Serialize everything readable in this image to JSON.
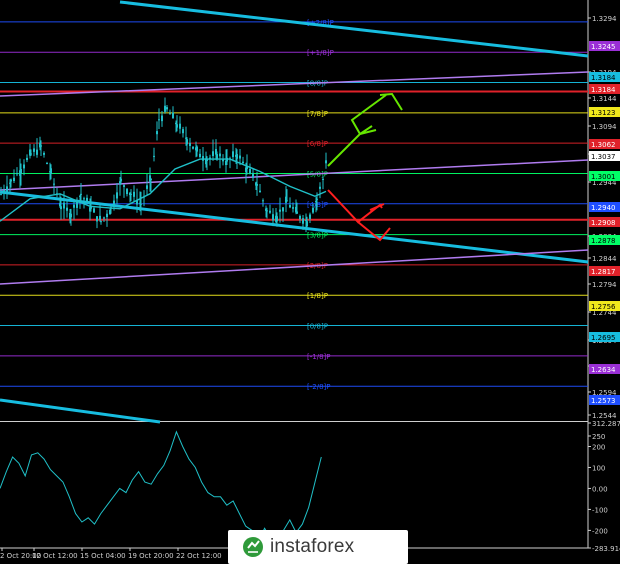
{
  "chart_data": {
    "type": "candlestick-with-oscillator",
    "price_axis_ticks": [
      "1.3294",
      "1.3194",
      "1.3144",
      "1.3094",
      "1.3037",
      "1.2944",
      "1.2894",
      "1.2844",
      "1.2794",
      "1.2744",
      "1.2694",
      "1.2644",
      "1.2594",
      "1.2544"
    ],
    "price_tags": [
      {
        "value": "1.3245",
        "color": "#9a2fd6"
      },
      {
        "value": "1.3184",
        "color": "#17bde0"
      },
      {
        "value": "1.3184",
        "color": "#e0222a"
      },
      {
        "value": "1.3123",
        "color": "#f0e81c"
      },
      {
        "value": "1.3062",
        "color": "#e0222a"
      },
      {
        "value": "1.3037",
        "color": "#ffffff"
      },
      {
        "value": "1.3001",
        "color": "#00ff66"
      },
      {
        "value": "1.2940",
        "color": "#1f4fff"
      },
      {
        "value": "1.2908",
        "color": "#e0222a"
      },
      {
        "value": "1.2878",
        "color": "#00ff66"
      },
      {
        "value": "1.2817",
        "color": "#e0222a"
      },
      {
        "value": "1.2756",
        "color": "#f0e81c"
      },
      {
        "value": "1.2695",
        "color": "#17bde0"
      },
      {
        "value": "1.2634",
        "color": "#9a2fd6"
      },
      {
        "value": "1.2573",
        "color": "#1f4fff"
      }
    ],
    "murrey_levels": [
      {
        "label": "[+2/8]P",
        "color": "#1f4fff"
      },
      {
        "label": "[+1/8]P",
        "color": "#9a2fd6"
      },
      {
        "label": "[8/8]P",
        "color": "#17bde0"
      },
      {
        "label": "[7/8]P",
        "color": "#f0e81c"
      },
      {
        "label": "[6/8]P",
        "color": "#e0222a"
      },
      {
        "label": "[5/8]P",
        "color": "#00ff66"
      },
      {
        "label": "[4/8]P",
        "color": "#1f4fff"
      },
      {
        "label": "[3/8]P",
        "color": "#00ff66"
      },
      {
        "label": "[2/8]P",
        "color": "#e0222a"
      },
      {
        "label": "[1/8]P",
        "color": "#f0e81c"
      },
      {
        "label": "[0/8]P",
        "color": "#17bde0"
      },
      {
        "label": "[-1/8]P",
        "color": "#9a2fd6"
      },
      {
        "label": "[-2/8]P",
        "color": "#1f4fff"
      }
    ],
    "oscillator_axis_ticks": [
      "312.2872",
      "250",
      "200",
      "100",
      "0.00",
      "-100",
      "-200",
      "-283.9145"
    ],
    "date_labels": [
      "2 Oct 20:00",
      "12 Oct 12:00",
      "15 Oct 04:00",
      "19 Oct 20:00",
      "22 Oct 12:00"
    ],
    "indicator_colors": {
      "oscillator": "#20c0c8",
      "moving_average": "#20c0c8",
      "candles": "#20c0c8"
    }
  },
  "watermark": {
    "brand": "instaforex"
  }
}
